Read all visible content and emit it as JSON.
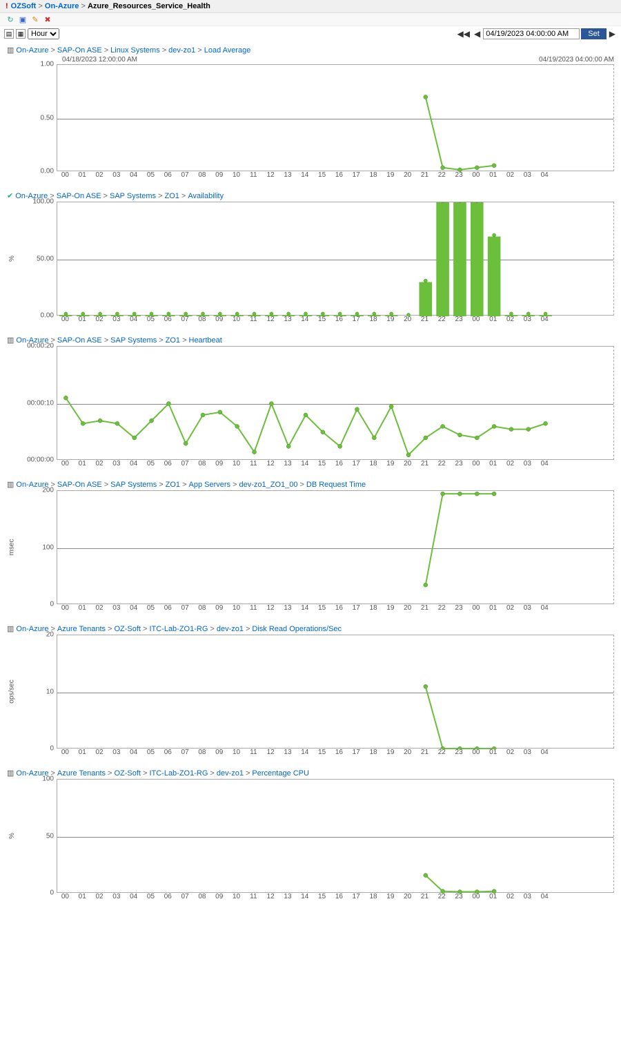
{
  "header": {
    "breadcrumb": [
      "OZSoft",
      "On-Azure",
      "Azure_Resources_Service_Health"
    ]
  },
  "controls": {
    "granularity_options": [
      "Hour"
    ],
    "granularity_selected": "Hour",
    "datetime_value": "04/19/2023 04:00:00 AM",
    "set_label": "Set"
  },
  "timestamps": {
    "start": "04/18/2023 12:00:00 AM",
    "end": "04/19/2023 04:00:00 AM"
  },
  "x_categories": [
    "00",
    "01",
    "02",
    "03",
    "04",
    "05",
    "06",
    "07",
    "08",
    "09",
    "10",
    "11",
    "12",
    "13",
    "14",
    "15",
    "16",
    "17",
    "18",
    "19",
    "20",
    "21",
    "22",
    "23",
    "00",
    "01",
    "02",
    "03",
    "04"
  ],
  "chart_data": [
    {
      "type": "line",
      "breadcrumb": [
        "On-Azure",
        "SAP-On ASE",
        "Linux Systems",
        "dev-zo1",
        "Load Average"
      ],
      "ylabel": "",
      "ylim": [
        0,
        1.0
      ],
      "yticks": [
        "0.00",
        "0.50",
        "1.00"
      ],
      "height": 155,
      "series": [
        {
          "name": "Load Average",
          "points": [
            [
              21,
              0.7
            ],
            [
              22,
              0.04
            ],
            [
              23,
              0.02
            ],
            [
              24,
              0.04
            ],
            [
              25,
              0.06
            ]
          ]
        }
      ]
    },
    {
      "type": "bar",
      "breadcrumb": [
        "On-Azure",
        "SAP-On ASE",
        "SAP Systems",
        "ZO1",
        "Availability"
      ],
      "status": "ok",
      "ylabel": "%",
      "ylim": [
        0,
        100
      ],
      "yticks": [
        "0.00",
        "50.00",
        "100.00"
      ],
      "height": 165,
      "values": [
        1,
        1,
        1,
        1,
        1,
        1,
        1,
        1,
        1,
        1,
        1,
        1,
        1,
        1,
        1,
        1,
        1,
        1,
        1,
        1,
        0,
        30,
        100,
        100,
        100,
        70,
        1,
        1,
        1
      ],
      "markers": true
    },
    {
      "type": "line",
      "breadcrumb": [
        "On-Azure",
        "SAP-On ASE",
        "SAP Systems",
        "ZO1",
        "Heartbeat"
      ],
      "ylabel": "",
      "ylim": [
        0,
        20
      ],
      "yticks": [
        "00:00:00",
        "00:00:10",
        "00:00:20"
      ],
      "height": 165,
      "series": [
        {
          "name": "Heartbeat",
          "points": [
            [
              0,
              11
            ],
            [
              1,
              6.5
            ],
            [
              2,
              7
            ],
            [
              3,
              6.5
            ],
            [
              4,
              4
            ],
            [
              5,
              7
            ],
            [
              6,
              10
            ],
            [
              7,
              3
            ],
            [
              8,
              8
            ],
            [
              9,
              8.5
            ],
            [
              10,
              6
            ],
            [
              11,
              1.5
            ],
            [
              12,
              10
            ],
            [
              13,
              2.5
            ],
            [
              14,
              8
            ],
            [
              15,
              5
            ],
            [
              16,
              2.5
            ],
            [
              17,
              9
            ],
            [
              18,
              4
            ],
            [
              19,
              9.5
            ],
            [
              20,
              1
            ],
            [
              21,
              4
            ],
            [
              22,
              6
            ],
            [
              23,
              4.5
            ],
            [
              24,
              4
            ],
            [
              25,
              6
            ],
            [
              26,
              5.5
            ],
            [
              27,
              5.5
            ],
            [
              28,
              6.5
            ]
          ]
        }
      ]
    },
    {
      "type": "line",
      "breadcrumb": [
        "On-Azure",
        "SAP-On ASE",
        "SAP Systems",
        "ZO1",
        "App Servers",
        "dev-zo1_ZO1_00",
        "DB Request Time"
      ],
      "ylabel": "msec",
      "ylim": [
        0,
        200
      ],
      "yticks": [
        "0",
        "100",
        "200"
      ],
      "height": 165,
      "series": [
        {
          "name": "DB Request Time",
          "points": [
            [
              21,
              35
            ],
            [
              22,
              195
            ],
            [
              23,
              195
            ],
            [
              24,
              195
            ],
            [
              25,
              195
            ]
          ]
        }
      ]
    },
    {
      "type": "line",
      "breadcrumb": [
        "On-Azure",
        "Azure Tenants",
        "OZ-Soft",
        "ITC-Lab-ZO1-RG",
        "dev-zo1",
        "Disk Read Operations/Sec"
      ],
      "ylabel": "ops/sec",
      "ylim": [
        0,
        20
      ],
      "yticks": [
        "0",
        "10",
        "20"
      ],
      "height": 165,
      "series": [
        {
          "name": "Disk Read",
          "points": [
            [
              21,
              11
            ],
            [
              22,
              0.1
            ],
            [
              23,
              0.1
            ],
            [
              24,
              0.1
            ],
            [
              25,
              0.1
            ]
          ]
        }
      ]
    },
    {
      "type": "line",
      "breadcrumb": [
        "On-Azure",
        "Azure Tenants",
        "OZ-Soft",
        "ITC-Lab-ZO1-RG",
        "dev-zo1",
        "Percentage CPU"
      ],
      "ylabel": "%",
      "ylim": [
        0,
        100
      ],
      "yticks": [
        "0",
        "50",
        "100"
      ],
      "height": 165,
      "series": [
        {
          "name": "CPU",
          "points": [
            [
              21,
              16
            ],
            [
              22,
              2
            ],
            [
              23,
              1.5
            ],
            [
              24,
              1.5
            ],
            [
              25,
              2
            ]
          ]
        }
      ]
    }
  ]
}
